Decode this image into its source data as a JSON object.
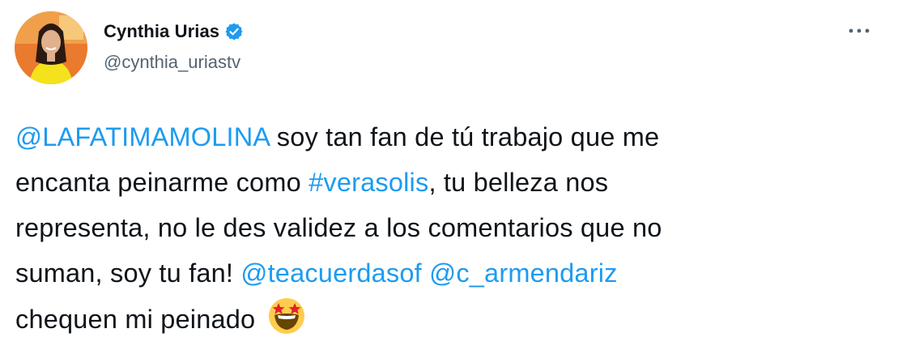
{
  "author": {
    "name": "Cynthia Urias",
    "handle": "@cynthia_uriastv"
  },
  "icons": {
    "verified": "verified-badge-icon",
    "more": "more-options-icon",
    "emoji": "star-struck-emoji"
  },
  "colors": {
    "link": "#1d9bf0",
    "text": "#0f1419",
    "secondary": "#536471"
  },
  "tweet": {
    "line1": {
      "mention": "@LAFATIMAMOLINA",
      "text": " soy tan fan de tú trabajo que me"
    },
    "line2": {
      "text_before": "encanta peinarme como ",
      "hashtag": "#verasolis",
      "text_after": ", tu belleza nos"
    },
    "line3": {
      "text": "representa, no le des validez a los comentarios que no"
    },
    "line4": {
      "text": "suman, soy tu fan! ",
      "mention1": "@teacuerdasof",
      "mention2": "@c_armendariz"
    },
    "line5": {
      "text": "chequen mi peinado"
    }
  }
}
